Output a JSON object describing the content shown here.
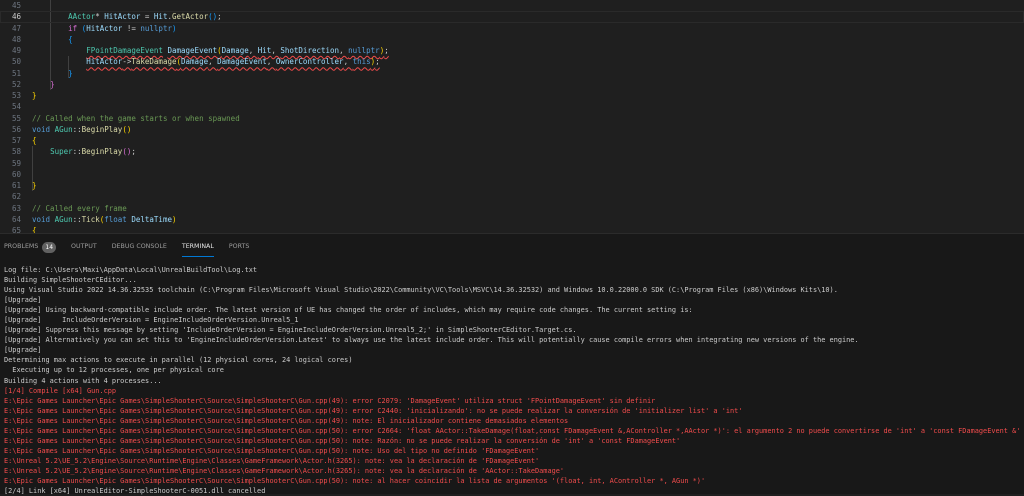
{
  "editor": {
    "current_line": 46,
    "squiggle_lines": [
      49,
      50
    ],
    "lines": [
      {
        "n": 45,
        "tokens": []
      },
      {
        "n": 46,
        "tokens": [
          [
            "        ",
            "pl"
          ],
          [
            "AActor",
            "ty"
          ],
          [
            "* ",
            "pl"
          ],
          [
            "HitActor",
            "va"
          ],
          [
            " = ",
            "pl"
          ],
          [
            "Hit",
            "va"
          ],
          [
            ".",
            "pl"
          ],
          [
            "GetActor",
            "fn"
          ],
          [
            "()",
            "b3"
          ],
          [
            ";",
            "pl"
          ]
        ]
      },
      {
        "n": 47,
        "tokens": [
          [
            "        ",
            "pl"
          ],
          [
            "if",
            "b2"
          ],
          [
            " ",
            "pl"
          ],
          [
            "(",
            "b3"
          ],
          [
            "HitActor",
            "va"
          ],
          [
            " != ",
            "pl"
          ],
          [
            "nullptr",
            "kw"
          ],
          [
            ")",
            "b3"
          ]
        ]
      },
      {
        "n": 48,
        "tokens": [
          [
            "        ",
            "pl"
          ],
          [
            "{",
            "b3"
          ]
        ]
      },
      {
        "n": 49,
        "tokens": [
          [
            "            ",
            "pl"
          ],
          [
            "FPointDamageEvent",
            "ty"
          ],
          [
            " ",
            "pl"
          ],
          [
            "DamageEvent",
            "va"
          ],
          [
            "(",
            "b1"
          ],
          [
            "Damage",
            "va"
          ],
          [
            ", ",
            "pl"
          ],
          [
            "Hit",
            "va"
          ],
          [
            ", ",
            "pl"
          ],
          [
            "ShotDirection",
            "va"
          ],
          [
            ", ",
            "pl"
          ],
          [
            "nullptr",
            "kw"
          ],
          [
            ")",
            "b1"
          ],
          [
            ";",
            "pl"
          ]
        ]
      },
      {
        "n": 50,
        "tokens": [
          [
            "            ",
            "pl"
          ],
          [
            "HitActor",
            "va"
          ],
          [
            "->",
            "pl"
          ],
          [
            "TakeDamage",
            "fn"
          ],
          [
            "(",
            "b1"
          ],
          [
            "Damage",
            "va"
          ],
          [
            ", ",
            "pl"
          ],
          [
            "DamageEvent",
            "va"
          ],
          [
            ", ",
            "pl"
          ],
          [
            "OwnerController",
            "va"
          ],
          [
            ", ",
            "pl"
          ],
          [
            "this",
            "kw"
          ],
          [
            ")",
            "b1"
          ],
          [
            ";",
            "pl"
          ]
        ]
      },
      {
        "n": 51,
        "tokens": [
          [
            "        ",
            "pl"
          ],
          [
            "}",
            "b3"
          ]
        ]
      },
      {
        "n": 52,
        "tokens": [
          [
            "    ",
            "pl"
          ],
          [
            "}",
            "b2"
          ]
        ]
      },
      {
        "n": 53,
        "tokens": [
          [
            "}",
            "b1"
          ]
        ]
      },
      {
        "n": 54,
        "tokens": []
      },
      {
        "n": 55,
        "tokens": [
          [
            "// Called when the game starts or when spawned",
            "cm"
          ]
        ]
      },
      {
        "n": 56,
        "tokens": [
          [
            "void",
            "kw"
          ],
          [
            " ",
            "pl"
          ],
          [
            "AGun",
            "ty"
          ],
          [
            "::",
            "pl"
          ],
          [
            "BeginPlay",
            "fn"
          ],
          [
            "()",
            "b1"
          ]
        ]
      },
      {
        "n": 57,
        "tokens": [
          [
            "{",
            "b1"
          ]
        ]
      },
      {
        "n": 58,
        "tokens": [
          [
            "    ",
            "pl"
          ],
          [
            "Super",
            "ty"
          ],
          [
            "::",
            "pl"
          ],
          [
            "BeginPlay",
            "fn"
          ],
          [
            "()",
            "b2"
          ],
          [
            ";",
            "pl"
          ]
        ]
      },
      {
        "n": 59,
        "tokens": []
      },
      {
        "n": 60,
        "tokens": []
      },
      {
        "n": 61,
        "tokens": [
          [
            "}",
            "b1"
          ]
        ]
      },
      {
        "n": 62,
        "tokens": []
      },
      {
        "n": 63,
        "tokens": [
          [
            "// Called every frame",
            "cm"
          ]
        ]
      },
      {
        "n": 64,
        "tokens": [
          [
            "void",
            "kw"
          ],
          [
            " ",
            "pl"
          ],
          [
            "AGun",
            "ty"
          ],
          [
            "::",
            "pl"
          ],
          [
            "Tick",
            "fn"
          ],
          [
            "(",
            "b1"
          ],
          [
            "float",
            "kw"
          ],
          [
            " ",
            "pl"
          ],
          [
            "DeltaTime",
            "va"
          ],
          [
            ")",
            "b1"
          ]
        ]
      },
      {
        "n": 65,
        "tokens": [
          [
            "{",
            "b1"
          ]
        ]
      }
    ]
  },
  "panel": {
    "tabs": [
      {
        "label": "PROBLEMS",
        "badge": "14"
      },
      {
        "label": "OUTPUT"
      },
      {
        "label": "DEBUG CONSOLE"
      },
      {
        "label": "TERMINAL",
        "active": true
      },
      {
        "label": "PORTS"
      }
    ],
    "terminal_lines": [
      {
        "text": "Log file: C:\\Users\\Maxi\\AppData\\Local\\UnrealBuildTool\\Log.txt"
      },
      {
        "text": "Building SimpleShooterCEditor..."
      },
      {
        "text": "Using Visual Studio 2022 14.36.32535 toolchain (C:\\Program Files\\Microsoft Visual Studio\\2022\\Community\\VC\\Tools\\MSVC\\14.36.32532) and Windows 10.0.22000.0 SDK (C:\\Program Files (x86)\\Windows Kits\\10)."
      },
      {
        "text": "[Upgrade]"
      },
      {
        "text": "[Upgrade] Using backward-compatible include order. The latest version of UE has changed the order of includes, which may require code changes. The current setting is:"
      },
      {
        "text": "[Upgrade]     IncludeOrderVersion = EngineIncludeOrderVersion.Unreal5_1"
      },
      {
        "text": "[Upgrade] Suppress this message by setting 'IncludeOrderVersion = EngineIncludeOrderVersion.Unreal5_2;' in SimpleShooterCEditor.Target.cs."
      },
      {
        "text": "[Upgrade] Alternatively you can set this to 'EngineIncludeOrderVersion.Latest' to always use the latest include order. This will potentially cause compile errors when integrating new versions of the engine."
      },
      {
        "text": "[Upgrade]"
      },
      {
        "text": "Determining max actions to execute in parallel (12 physical cores, 24 logical cores)"
      },
      {
        "text": "  Executing up to 12 processes, one per physical core"
      },
      {
        "text": "Building 4 actions with 4 processes..."
      },
      {
        "text": "[1/4] Compile [x64] Gun.cpp",
        "error": true
      },
      {
        "text": "E:\\Epic Games Launcher\\Epic Games\\SimpleShooterC\\Source\\SimpleShooterC\\Gun.cpp(49): error C2079: 'DamageEvent' utiliza struct 'FPointDamageEvent' sin definir",
        "error": true
      },
      {
        "text": "E:\\Epic Games Launcher\\Epic Games\\SimpleShooterC\\Source\\SimpleShooterC\\Gun.cpp(49): error C2440: 'inicializando': no se puede realizar la conversión de 'initializer list' a 'int'",
        "error": true
      },
      {
        "text": "E:\\Epic Games Launcher\\Epic Games\\SimpleShooterC\\Source\\SimpleShooterC\\Gun.cpp(49): note: El inicializador contiene demasiados elementos",
        "error": true
      },
      {
        "text": "E:\\Epic Games Launcher\\Epic Games\\SimpleShooterC\\Source\\SimpleShooterC\\Gun.cpp(50): error C2664: 'float AActor::TakeDamage(float,const FDamageEvent &,AController *,AActor *)': el argumento 2 no puede convertirse de 'int' a 'const FDamageEvent &'",
        "error": true
      },
      {
        "text": "E:\\Epic Games Launcher\\Epic Games\\SimpleShooterC\\Source\\SimpleShooterC\\Gun.cpp(50): note: Razón: no se puede realizar la conversión de 'int' a 'const FDamageEvent'",
        "error": true
      },
      {
        "text": "E:\\Epic Games Launcher\\Epic Games\\SimpleShooterC\\Source\\SimpleShooterC\\Gun.cpp(50): note: Uso del tipo no definido 'FDamageEvent'",
        "error": true
      },
      {
        "text": "E:\\Unreal 5.2\\UE_5.2\\Engine\\Source\\Runtime\\Engine\\Classes\\GameFramework\\Actor.h(3265): note: vea la declaración de 'FDamageEvent'",
        "error": true
      },
      {
        "text": "E:\\Unreal 5.2\\UE_5.2\\Engine\\Source\\Runtime\\Engine\\Classes\\GameFramework\\Actor.h(3265): note: vea la declaración de 'AActor::TakeDamage'",
        "error": true
      },
      {
        "text": "E:\\Epic Games Launcher\\Epic Games\\SimpleShooterC\\Source\\SimpleShooterC\\Gun.cpp(50): note: al hacer coincidir la lista de argumentos '(float, int, AController *, AGun *)'",
        "error": true
      },
      {
        "text": "[2/4] Link [x64] UnrealEditor-SimpleShooterC-0051.dll cancelled"
      }
    ]
  }
}
